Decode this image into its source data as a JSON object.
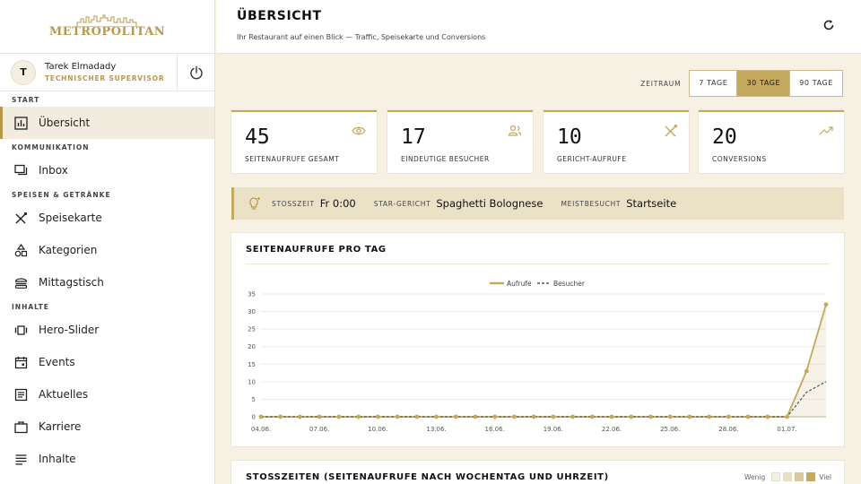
{
  "brand": {
    "name": "METROPOLITAN",
    "accent": "#c3a85d"
  },
  "user": {
    "initial": "T",
    "name": "Tarek Elmadady",
    "role": "TECHNISCHER SUPERVISOR"
  },
  "sidebar": {
    "sections": {
      "start": "START",
      "kommunikation": "KOMMUNIKATION",
      "speisen": "SPEISEN & GETRÄNKE",
      "inhalte": "INHALTE"
    },
    "items": {
      "uebersicht": "Übersicht",
      "inbox": "Inbox",
      "speisekarte": "Speisekarte",
      "kategorien": "Kategorien",
      "mittagstisch": "Mittagstisch",
      "hero_slider": "Hero-Slider",
      "events": "Events",
      "aktuelles": "Aktuelles",
      "karriere": "Karriere",
      "inhalte": "Inhalte"
    }
  },
  "header": {
    "title": "ÜBERSICHT",
    "subtitle": "Ihr Restaurant auf einen Blick — Traffic, Speisekarte und Conversions"
  },
  "period": {
    "label": "ZEITRAUM",
    "options": [
      "7 TAGE",
      "30 TAGE",
      "90 TAGE"
    ],
    "selected": "30 TAGE"
  },
  "kpis": [
    {
      "value": "45",
      "label": "SEITENAUFRUFE GESAMT",
      "icon": "eye-icon"
    },
    {
      "value": "17",
      "label": "EINDEUTIGE BESUCHER",
      "icon": "users-icon"
    },
    {
      "value": "10",
      "label": "GERICHT-AUFRUFE",
      "icon": "utensils-icon"
    },
    {
      "value": "20",
      "label": "CONVERSIONS",
      "icon": "trending-up-icon"
    }
  ],
  "strip": {
    "peak_label": "STOSSZEIT",
    "peak_value": "Fr 0:00",
    "star_label": "STAR-GERICHT",
    "star_value": "Spaghetti Bolognese",
    "most_label": "MEISTBESUCHT",
    "most_value": "Startseite"
  },
  "chart_card": {
    "title": "SEITENAUFRUFE PRO TAG"
  },
  "chart_data": {
    "type": "line",
    "title": "SEITENAUFRUFE PRO TAG",
    "x": [
      "04.06.",
      "05.06.",
      "06.06.",
      "07.06.",
      "08.06.",
      "09.06.",
      "10.06.",
      "11.06.",
      "12.06.",
      "13.06.",
      "14.06.",
      "15.06.",
      "16.06.",
      "17.06.",
      "18.06.",
      "19.06.",
      "20.06.",
      "21.06.",
      "22.06.",
      "23.06.",
      "24.06.",
      "25.06.",
      "26.06.",
      "27.06.",
      "28.06.",
      "29.06.",
      "30.06.",
      "01.07.",
      "02.07.",
      "03.07."
    ],
    "xtick_labels": [
      "04.06.",
      "07.06.",
      "10.06.",
      "13.06.",
      "16.06.",
      "19.06.",
      "22.06.",
      "25.06.",
      "28.06.",
      "01.07."
    ],
    "series": [
      {
        "name": "Aufrufe",
        "style": "solid",
        "color": "#c3a85d",
        "values": [
          0,
          0,
          0,
          0,
          0,
          0,
          0,
          0,
          0,
          0,
          0,
          0,
          0,
          0,
          0,
          0,
          0,
          0,
          0,
          0,
          0,
          0,
          0,
          0,
          0,
          0,
          0,
          0,
          13,
          32
        ]
      },
      {
        "name": "Besucher",
        "style": "dashed",
        "color": "#555555",
        "values": [
          0,
          0,
          0,
          0,
          0,
          0,
          0,
          0,
          0,
          0,
          0,
          0,
          0,
          0,
          0,
          0,
          0,
          0,
          0,
          0,
          0,
          0,
          0,
          0,
          0,
          0,
          0,
          0,
          7,
          10
        ]
      }
    ],
    "ylim": [
      0,
      35
    ],
    "yticks": [
      0,
      5,
      10,
      15,
      20,
      25,
      30,
      35
    ],
    "legend_position": "top-center",
    "grid": true
  },
  "heatmap_card": {
    "title": "STOSSZEITEN (SEITENAUFRUFE NACH WOCHENTAG UND UHRZEIT)",
    "legend_low": "Wenig",
    "legend_high": "Viel",
    "legend_colors": [
      "#f3efe3",
      "#e8dfc5",
      "#d9c99c",
      "#c3a85d"
    ]
  }
}
